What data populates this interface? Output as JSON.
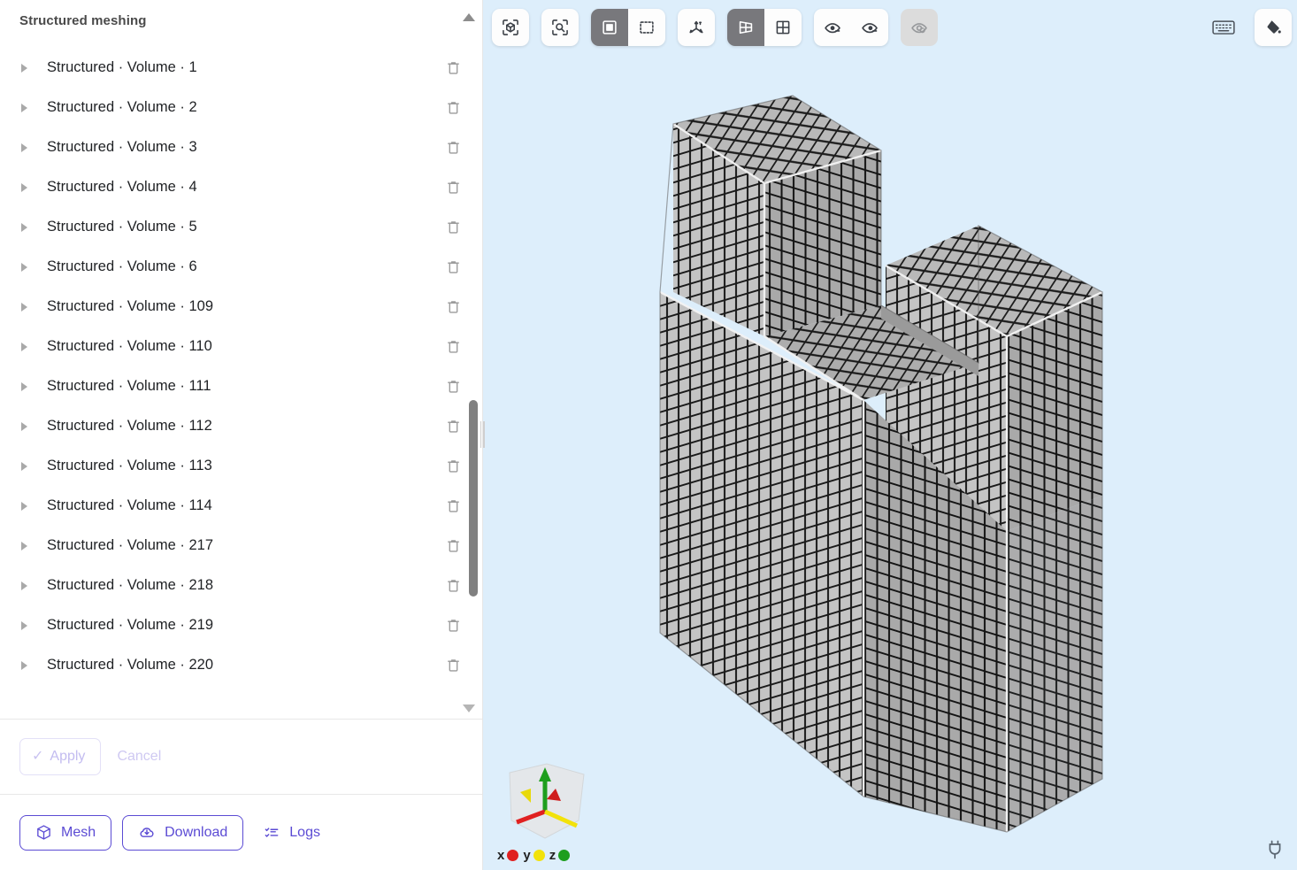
{
  "sidebar": {
    "title": "Structured meshing",
    "scroll_up_icon": "triangle-up-icon",
    "scroll_down_icon": "triangle-down-icon",
    "row_prefix": "Structured",
    "row_middle": "Volume",
    "separator": "·",
    "delete_icon": "trash-icon",
    "expand_icon": "caret-right-icon",
    "items": [
      {
        "type": "Structured",
        "entity": "Volume",
        "id": "1",
        "label": "Structured · Volume · 1"
      },
      {
        "type": "Structured",
        "entity": "Volume",
        "id": "2",
        "label": "Structured · Volume · 2"
      },
      {
        "type": "Structured",
        "entity": "Volume",
        "id": "3",
        "label": "Structured · Volume · 3"
      },
      {
        "type": "Structured",
        "entity": "Volume",
        "id": "4",
        "label": "Structured · Volume · 4"
      },
      {
        "type": "Structured",
        "entity": "Volume",
        "id": "5",
        "label": "Structured · Volume · 5"
      },
      {
        "type": "Structured",
        "entity": "Volume",
        "id": "6",
        "label": "Structured · Volume · 6"
      },
      {
        "type": "Structured",
        "entity": "Volume",
        "id": "109",
        "label": "Structured · Volume · 109"
      },
      {
        "type": "Structured",
        "entity": "Volume",
        "id": "110",
        "label": "Structured · Volume · 110"
      },
      {
        "type": "Structured",
        "entity": "Volume",
        "id": "111",
        "label": "Structured · Volume · 111"
      },
      {
        "type": "Structured",
        "entity": "Volume",
        "id": "112",
        "label": "Structured · Volume · 112"
      },
      {
        "type": "Structured",
        "entity": "Volume",
        "id": "113",
        "label": "Structured · Volume · 113"
      },
      {
        "type": "Structured",
        "entity": "Volume",
        "id": "114",
        "label": "Structured · Volume · 114"
      },
      {
        "type": "Structured",
        "entity": "Volume",
        "id": "217",
        "label": "Structured · Volume · 217"
      },
      {
        "type": "Structured",
        "entity": "Volume",
        "id": "218",
        "label": "Structured · Volume · 218"
      },
      {
        "type": "Structured",
        "entity": "Volume",
        "id": "219",
        "label": "Structured · Volume · 219"
      },
      {
        "type": "Structured",
        "entity": "Volume",
        "id": "220",
        "label": "Structured · Volume · 220"
      }
    ]
  },
  "actions": {
    "apply_label": "Apply",
    "apply_enabled": false,
    "apply_icon": "check-icon",
    "cancel_label": "Cancel",
    "cancel_enabled": false
  },
  "footer": {
    "mesh_label": "Mesh",
    "mesh_icon": "cube-icon",
    "download_label": "Download",
    "download_icon": "cloud-download-icon",
    "logs_label": "Logs",
    "logs_icon": "list-check-icon"
  },
  "toolbar": {
    "buttons": [
      {
        "name": "fit-to-view-button",
        "icon": "cube-focus-icon",
        "state": "normal"
      },
      {
        "name": "zoom-to-selection-button",
        "icon": "magnifier-frame-icon",
        "state": "normal"
      },
      {
        "name": "select-single-button",
        "icon": "solid-square-icon",
        "state": "active"
      },
      {
        "name": "select-box-button",
        "icon": "dashed-square-icon",
        "state": "normal"
      },
      {
        "name": "axes-toggle-button",
        "icon": "axes-icon",
        "state": "normal"
      },
      {
        "name": "perspective-view-button",
        "icon": "perspective-icon",
        "state": "active"
      },
      {
        "name": "orthographic-view-button",
        "icon": "grid-square-icon",
        "state": "normal"
      },
      {
        "name": "hide-selected-button",
        "icon": "eye-minus-icon",
        "state": "normal"
      },
      {
        "name": "isolate-selected-button",
        "icon": "eye-dash-icon",
        "state": "normal"
      },
      {
        "name": "reset-visibility-button",
        "icon": "eye-reset-icon",
        "state": "disabled"
      },
      {
        "name": "keyboard-shortcuts-button",
        "icon": "keyboard-icon",
        "state": "normal"
      },
      {
        "name": "background-color-button",
        "icon": "paint-bucket-icon",
        "state": "normal"
      }
    ]
  },
  "viewport": {
    "background_color": "#ddeefb",
    "mesh_fill": "#b4b4b4",
    "mesh_edge_color": "#1b1b1b",
    "mesh_highlight_color": "#f2f2f2",
    "gizmo": {
      "x_label": "x",
      "x_color": "#e02020",
      "y_label": "y",
      "y_color": "#f2e20a",
      "z_label": "z",
      "z_color": "#1e9e1e",
      "icon": "axis-gizmo-icon"
    },
    "status_icon": "power-plug-icon"
  }
}
